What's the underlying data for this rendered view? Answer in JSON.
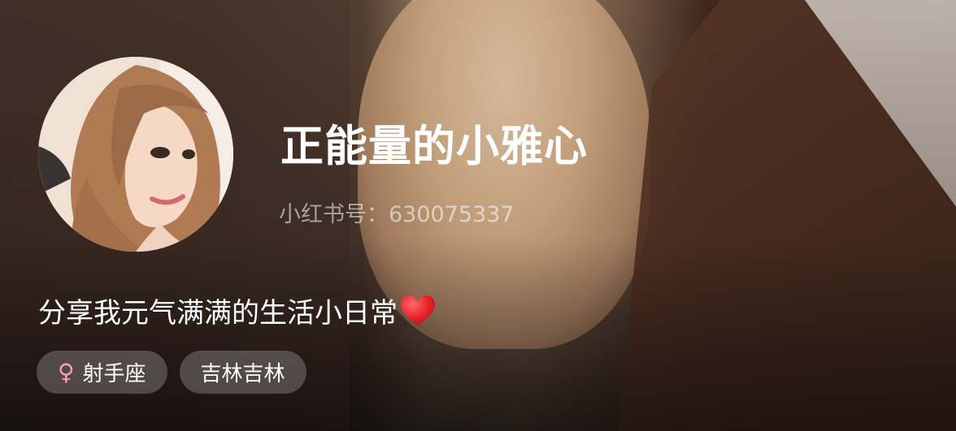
{
  "profile": {
    "nickname": "正能量的小雅心",
    "red_id_label": "小红书号：",
    "red_id": "630075337",
    "bio": "分享我元气满满的生活小日常",
    "bio_emoji": "heart-icon",
    "tags": [
      {
        "icon": "female-icon",
        "icon_glyph": "♀",
        "label": "射手座"
      },
      {
        "label": "吉林吉林"
      }
    ]
  },
  "colors": {
    "female_icon": "#f5a0b8",
    "heart": "#e8242e",
    "tag_background": "rgba(255,255,255,0.22)"
  }
}
